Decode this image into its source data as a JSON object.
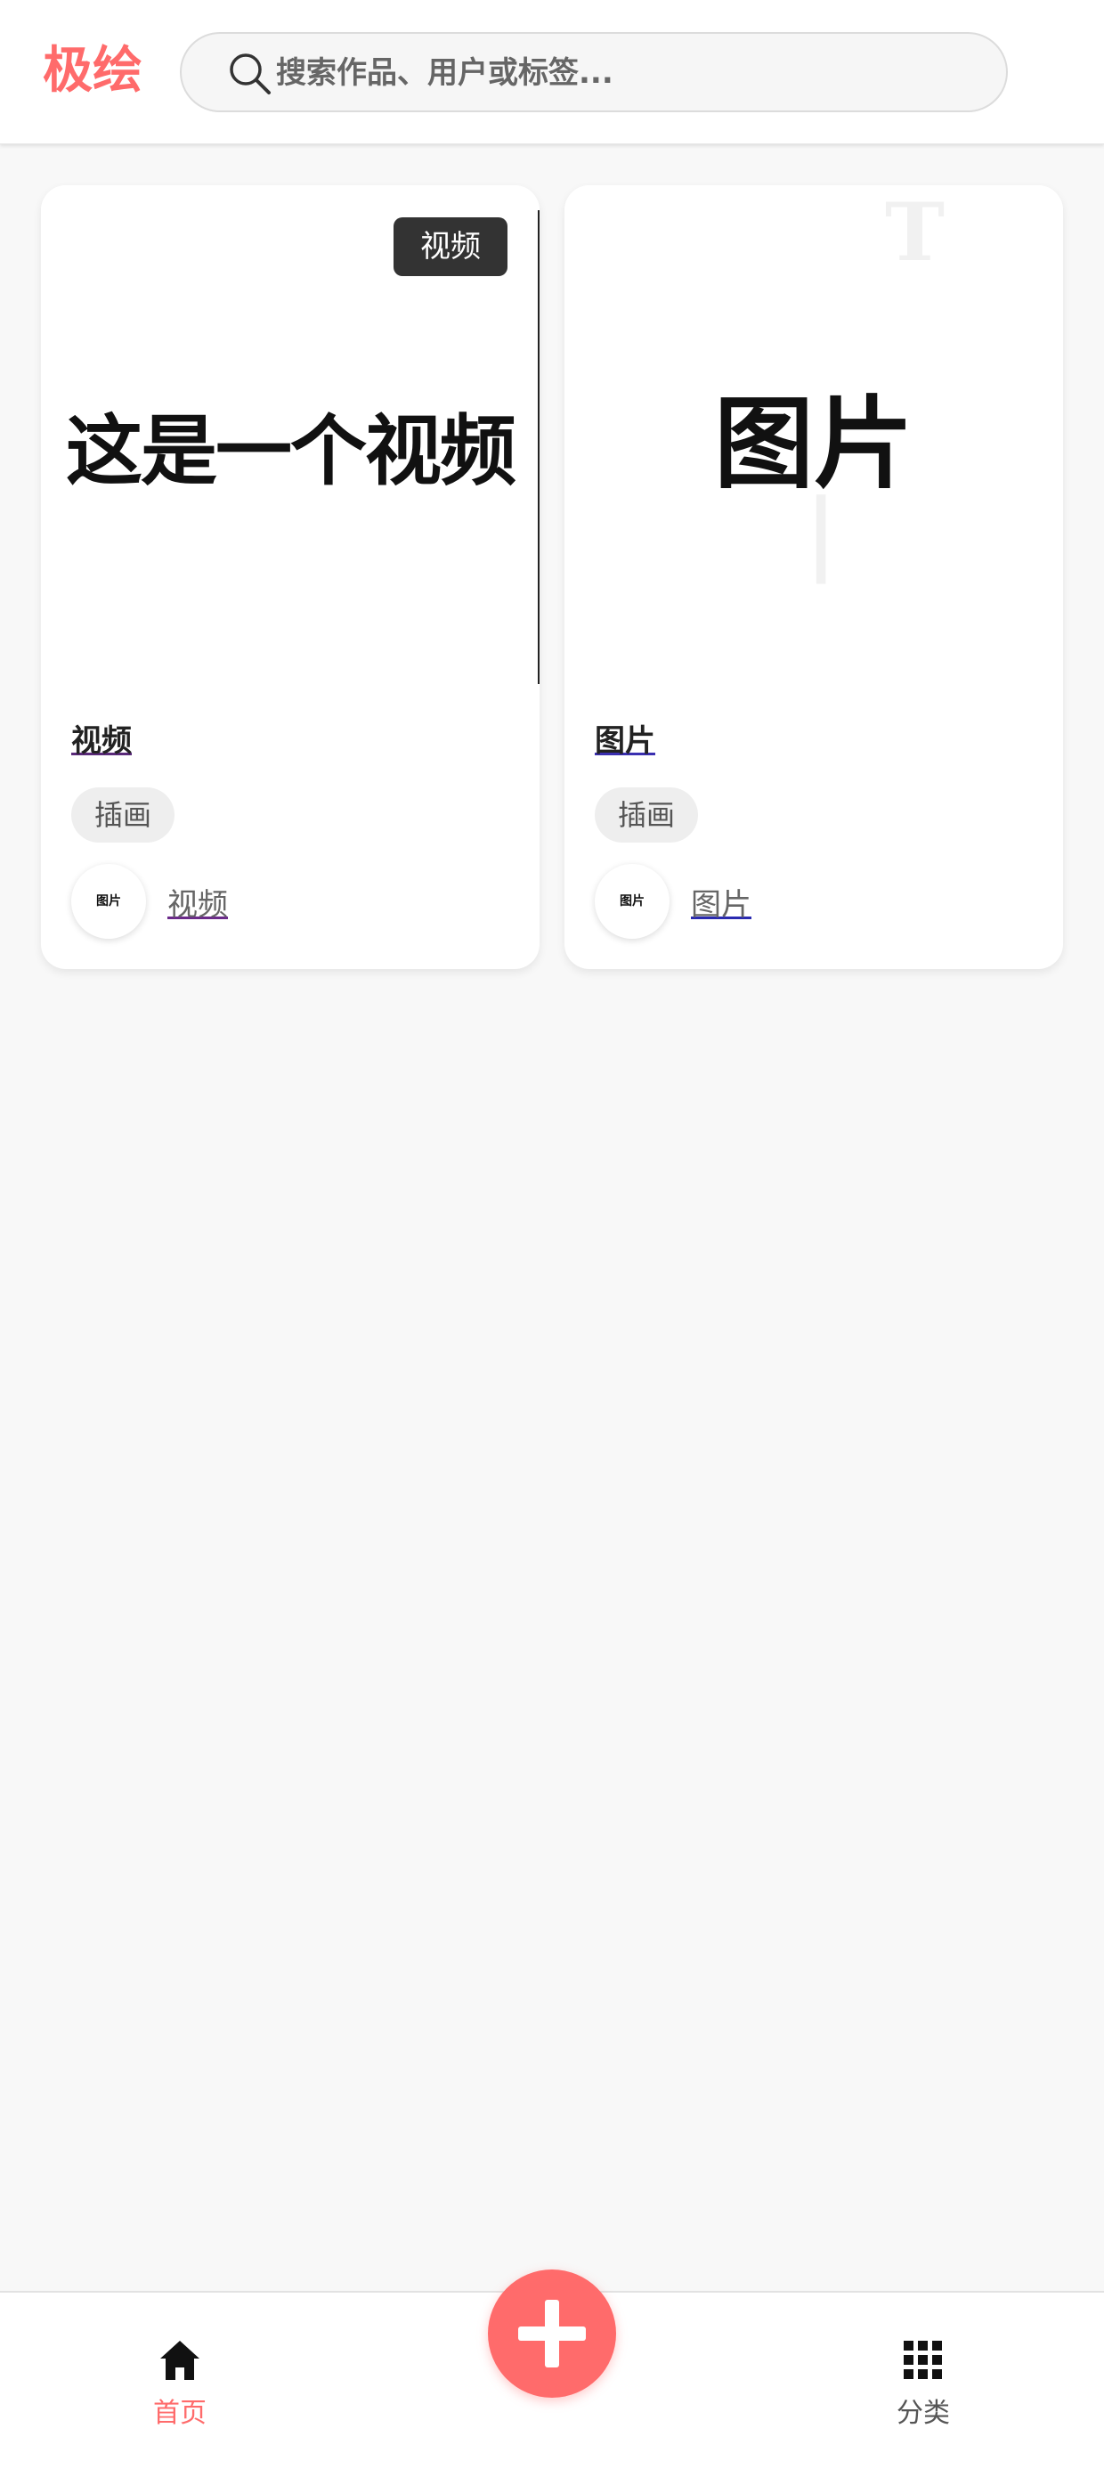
{
  "app": {
    "logo": "极绘",
    "brand_color": "#ff6b6b"
  },
  "search": {
    "placeholder": "搜索作品、用户或标签...",
    "value": ""
  },
  "works": [
    {
      "thumb_text": "这是一个视频",
      "badge": "视频",
      "title": "视频",
      "tag": "插画",
      "avatar_text": "图片",
      "author": "视频"
    },
    {
      "thumb_text": "图片",
      "title": "图片",
      "tag": "插画",
      "avatar_text": "图片",
      "author": "图片"
    }
  ],
  "nav": {
    "home_label": "首页",
    "category_label": "分类",
    "home_icon": "home-icon",
    "category_icon": "grid-icon",
    "add_icon": "plus-icon"
  }
}
